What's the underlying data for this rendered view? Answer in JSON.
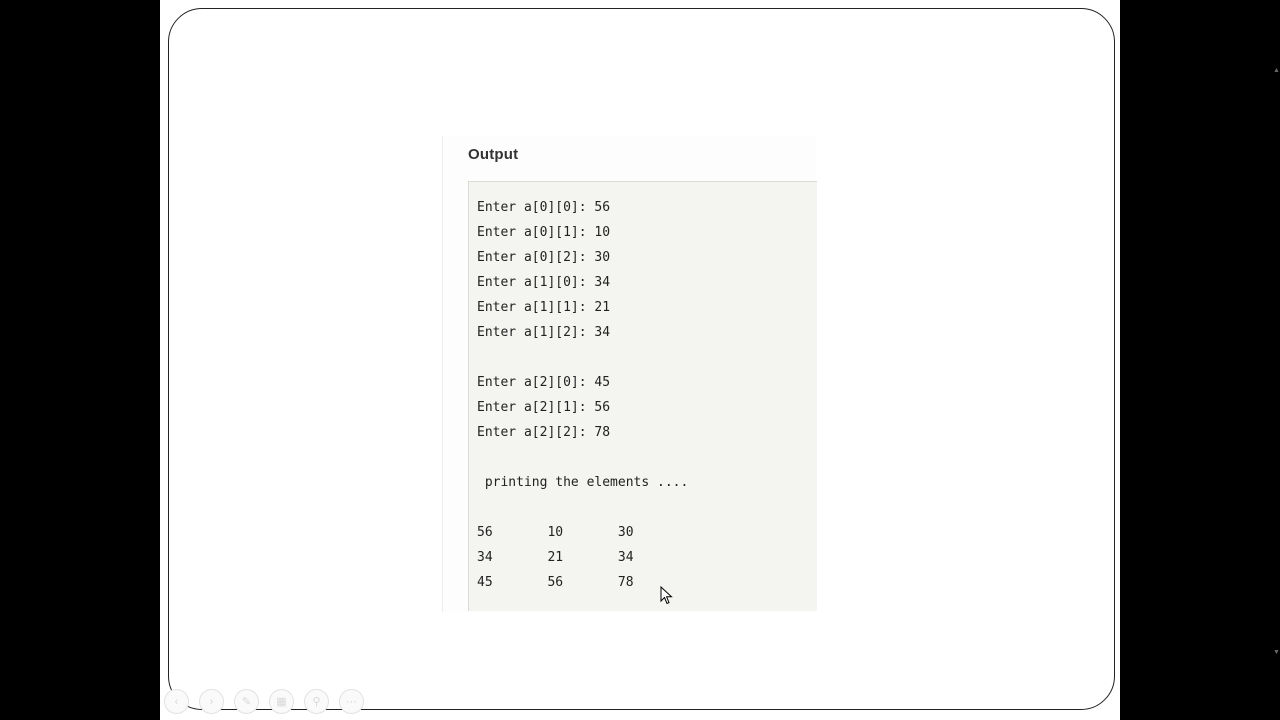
{
  "output": {
    "heading": "Output",
    "console": {
      "lines": [
        "Enter a[0][0]: 56",
        "Enter a[0][1]: 10",
        "Enter a[0][2]: 30",
        "Enter a[1][0]: 34",
        "Enter a[1][1]: 21",
        "Enter a[1][2]: 34",
        "Enter a[2][0]: 45",
        "Enter a[2][1]: 56",
        "Enter a[2][2]: 78",
        " printing the elements ....",
        "56       10       30",
        "34       21       34",
        "45       56       78"
      ]
    }
  },
  "toolbar": {
    "buttons": [
      {
        "icon": "previous-icon",
        "glyph": "‹"
      },
      {
        "icon": "next-icon",
        "glyph": "›"
      },
      {
        "icon": "pen-icon",
        "glyph": "✎"
      },
      {
        "icon": "slides-icon",
        "glyph": "▦"
      },
      {
        "icon": "zoom-icon",
        "glyph": "⚲"
      },
      {
        "icon": "more-icon",
        "glyph": "⋯"
      }
    ]
  },
  "colors": {
    "background": "#000000",
    "slide": "#ffffff",
    "console_bg": "#f4f5f1",
    "text": "#222222"
  }
}
